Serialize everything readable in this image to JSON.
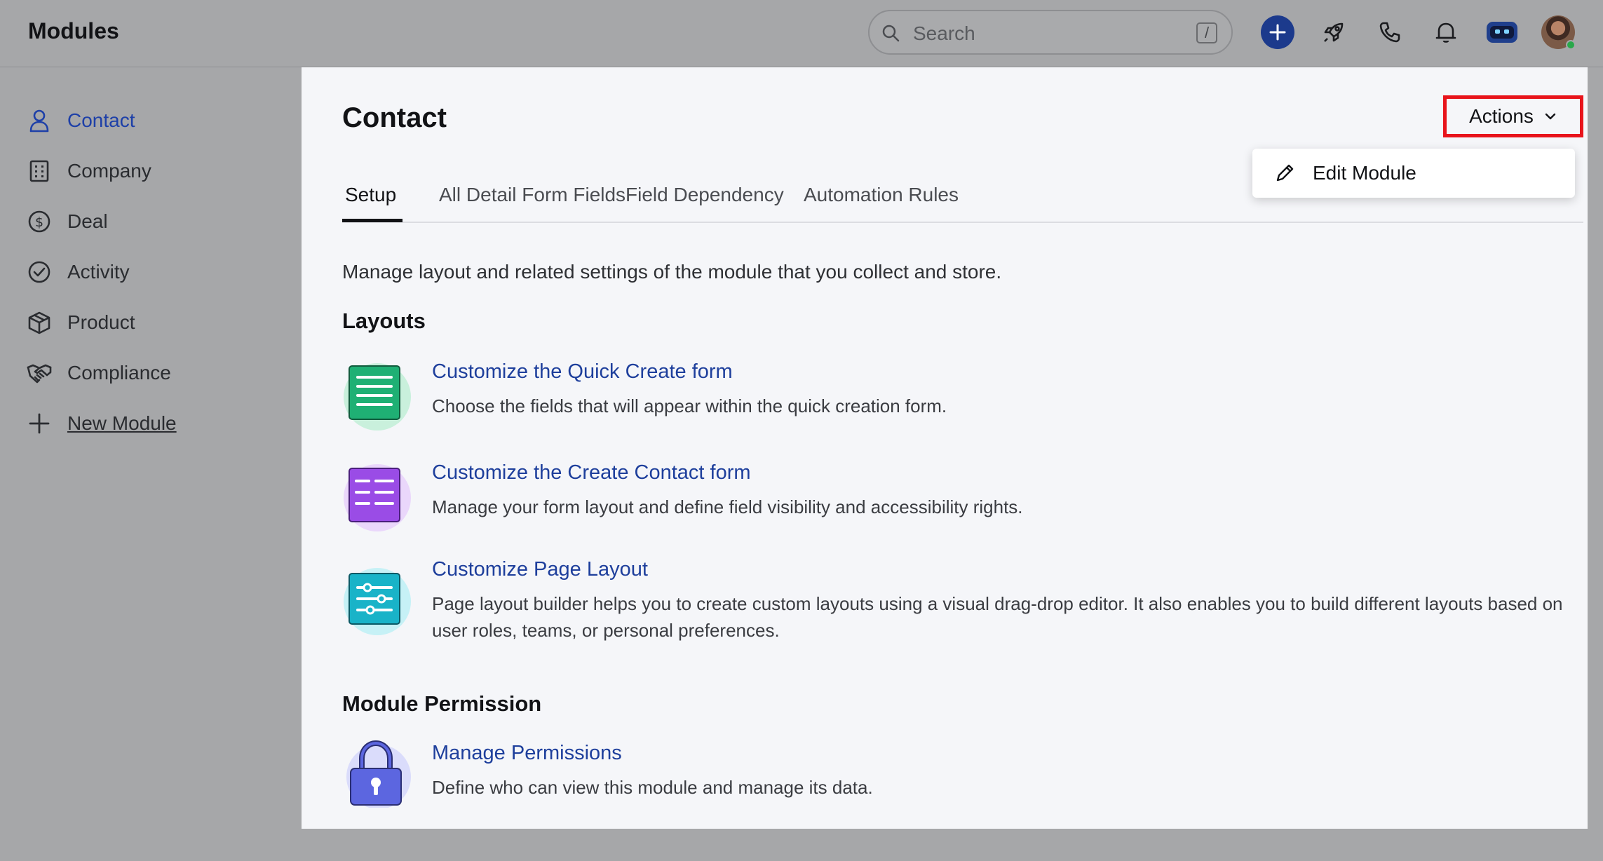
{
  "header": {
    "title": "Modules",
    "search": {
      "placeholder": "Search",
      "shortcut": "/"
    },
    "icons": [
      "plus-icon",
      "rocket-icon",
      "phone-icon",
      "bell-icon",
      "bot-icon",
      "avatar"
    ]
  },
  "sidebar": {
    "items": [
      {
        "label": "Contact",
        "icon": "user-icon",
        "active": true
      },
      {
        "label": "Company",
        "icon": "building-icon"
      },
      {
        "label": "Deal",
        "icon": "dollar-icon"
      },
      {
        "label": "Activity",
        "icon": "check-circle-icon"
      },
      {
        "label": "Product",
        "icon": "box-icon"
      },
      {
        "label": "Compliance",
        "icon": "handshake-icon"
      }
    ],
    "new_module": "New Module"
  },
  "main": {
    "title": "Contact",
    "actions_label": "Actions",
    "dropdown": {
      "edit_module": "Edit Module"
    },
    "tabs": [
      "Setup",
      "All Detail Form Fields",
      "Field Dependency",
      "Automation Rules"
    ],
    "active_tab": "Setup",
    "intro": "Manage layout and related settings of the module that you collect and store.",
    "layouts_title": "Layouts",
    "layouts": [
      {
        "title": "Customize the Quick Create form",
        "description": "Choose the fields that will appear within the quick creation form."
      },
      {
        "title": "Customize the Create Contact form",
        "description": "Manage your form layout and define field visibility and accessibility rights."
      },
      {
        "title": "Customize Page Layout",
        "description": "Page layout builder helps you to create custom layouts using a visual drag-drop editor. It also enables you to build different layouts based on user roles, teams, or personal preferences."
      }
    ],
    "permission_title": "Module Permission",
    "permission": {
      "title": "Manage Permissions",
      "description": "Define who can view this module and manage its data."
    }
  },
  "colors": {
    "accent": "#1e40a8",
    "highlight_border": "#e8141b",
    "green_tile": "#1fb074",
    "purple_tile": "#9a4ce6",
    "teal_tile": "#19b3c8",
    "lock_tile": "#5c66e0"
  }
}
